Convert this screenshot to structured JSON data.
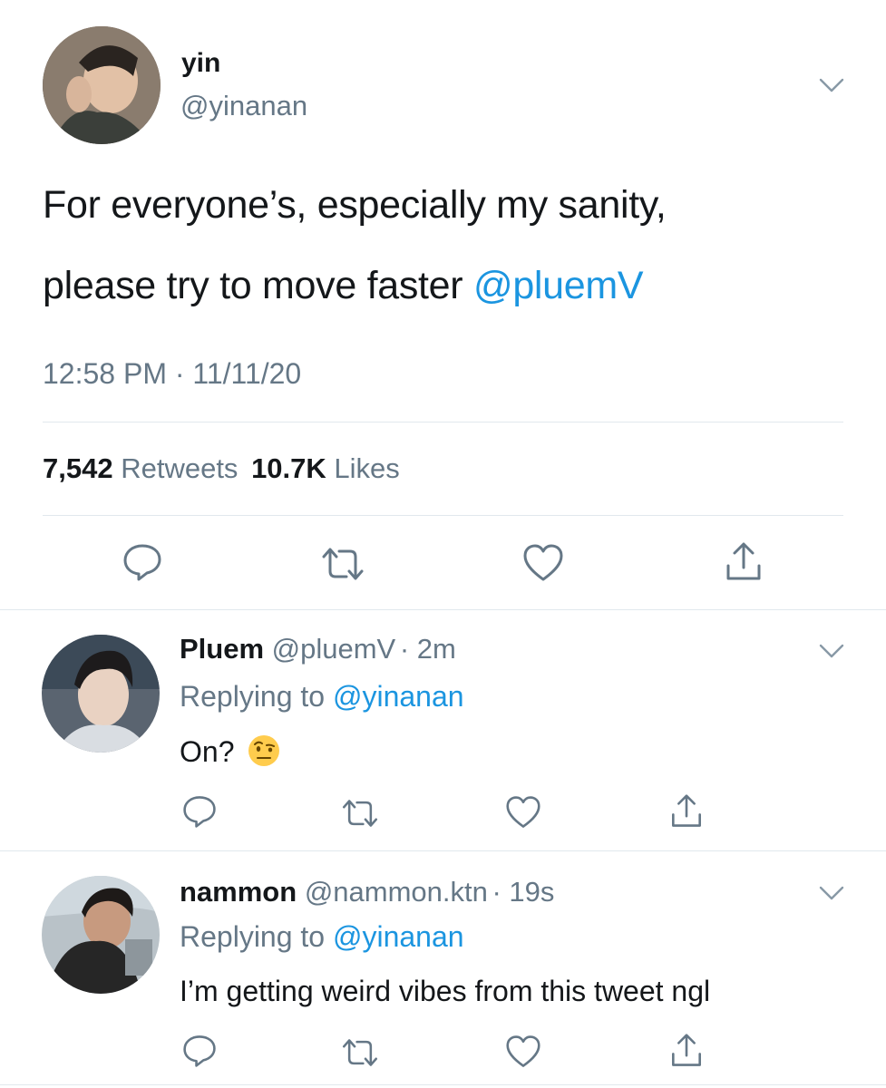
{
  "main_tweet": {
    "display_name": "yin",
    "handle": "@yinanan",
    "text": "For everyone’s, especially my sanity,",
    "text_line2": "please try to move faster ",
    "mention": "@pluemV",
    "timestamp": "12:58 PM · 11/11/20",
    "retweets_count": "7,542",
    "retweets_label": "Retweets",
    "likes_count": "10.7K",
    "likes_label": "Likes"
  },
  "replies": [
    {
      "display_name": "Pluem",
      "handle": "@pluemV",
      "time": "· 2m",
      "replying_label": "Replying to ",
      "replying_to": "@yinanan",
      "text": "On?",
      "emoji": "🤨"
    },
    {
      "display_name": "nammon",
      "handle": "@nammon.ktn",
      "time": "· 19s",
      "replying_label": "Replying to ",
      "replying_to": "@yinanan",
      "text": "I’m getting weird vibes from this tweet ngl"
    }
  ],
  "icons": {
    "reply": "reply-icon",
    "retweet": "retweet-icon",
    "like": "heart-icon",
    "share": "share-icon",
    "more": "chevron-down-icon"
  },
  "colors": {
    "link": "#1b95e0",
    "secondary": "#657786",
    "text": "#14171a",
    "divider": "#e1e8ed"
  }
}
